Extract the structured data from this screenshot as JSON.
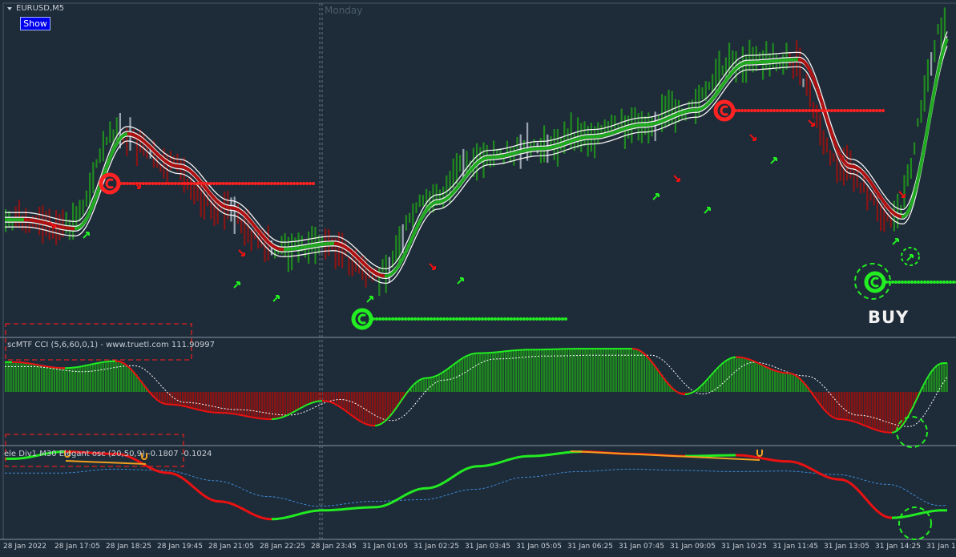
{
  "chart_header": {
    "symbol": "EURUSD,M5",
    "show_button_label": "Show",
    "day_label": "Monday"
  },
  "indicators": {
    "cci_label": "scMTF CCI (5,6,60,0,1) - www.truetl.com 111.90997",
    "osc_label": "ele Div1 M30 Elegant osc (20,50,9) -0.1807 -0.1024"
  },
  "signal": {
    "buy_label": "BUY"
  },
  "time_axis": {
    "labels": [
      "28 Jan 2022",
      "28 Jan 17:05",
      "28 Jan 18:25",
      "28 Jan 19:45",
      "28 Jan 21:05",
      "28 Jan 22:25",
      "28 Jan 23:45",
      "31 Jan 01:05",
      "31 Jan 02:25",
      "31 Jan 03:45",
      "31 Jan 05:05",
      "31 Jan 06:25",
      "31 Jan 07:45",
      "31 Jan 09:05",
      "31 Jan 10:25",
      "31 Jan 11:45",
      "31 Jan 13:05",
      "31 Jan 14:25",
      "31 Jan 1"
    ]
  },
  "colors": {
    "background": "#1e2b38",
    "bull": "#1f8a1f",
    "bear": "#8a1414",
    "line_green": "#22ee22",
    "line_red": "#ee1111",
    "signal_dots_red": "#ff2222",
    "signal_dots_green": "#22ee22",
    "annotation_red": "#e02020"
  },
  "chart_data": {
    "type": "line",
    "title": "EURUSD,M5",
    "x": [
      "28 Jan 2022",
      "28 Jan 17:05",
      "28 Jan 18:25",
      "28 Jan 19:45",
      "28 Jan 21:05",
      "28 Jan 22:25",
      "28 Jan 23:45",
      "31 Jan 01:05",
      "31 Jan 02:25",
      "31 Jan 03:45",
      "31 Jan 05:05",
      "31 Jan 06:25",
      "31 Jan 07:45",
      "31 Jan 09:05",
      "31 Jan 10:25",
      "31 Jan 11:45",
      "31 Jan 13:05",
      "31 Jan 14:25",
      "31 Jan 1"
    ],
    "series": [
      {
        "values": [
          0.34,
          0.31,
          0.63,
          0.52,
          0.38,
          0.24,
          0.26,
          0.15,
          0.4,
          0.55,
          0.58,
          0.62,
          0.66,
          0.71,
          0.87,
          0.88,
          0.52,
          0.35,
          0.98
        ]
      }
    ],
    "cci_values": [
      0.6,
      0.48,
      0.62,
      -0.25,
      -0.42,
      -0.55,
      -0.18,
      -0.68,
      0.28,
      0.78,
      0.85,
      0.87,
      0.87,
      -0.05,
      0.7,
      0.38,
      -0.55,
      -0.82,
      0.58
    ],
    "osc_values": [
      0.72,
      0.88,
      0.83,
      0.4,
      -0.25,
      -0.65,
      -0.45,
      -0.38,
      0.05,
      0.55,
      0.78,
      0.88,
      0.83,
      0.78,
      0.8,
      0.66,
      0.25,
      -0.62,
      -0.45
    ],
    "grid": false
  }
}
